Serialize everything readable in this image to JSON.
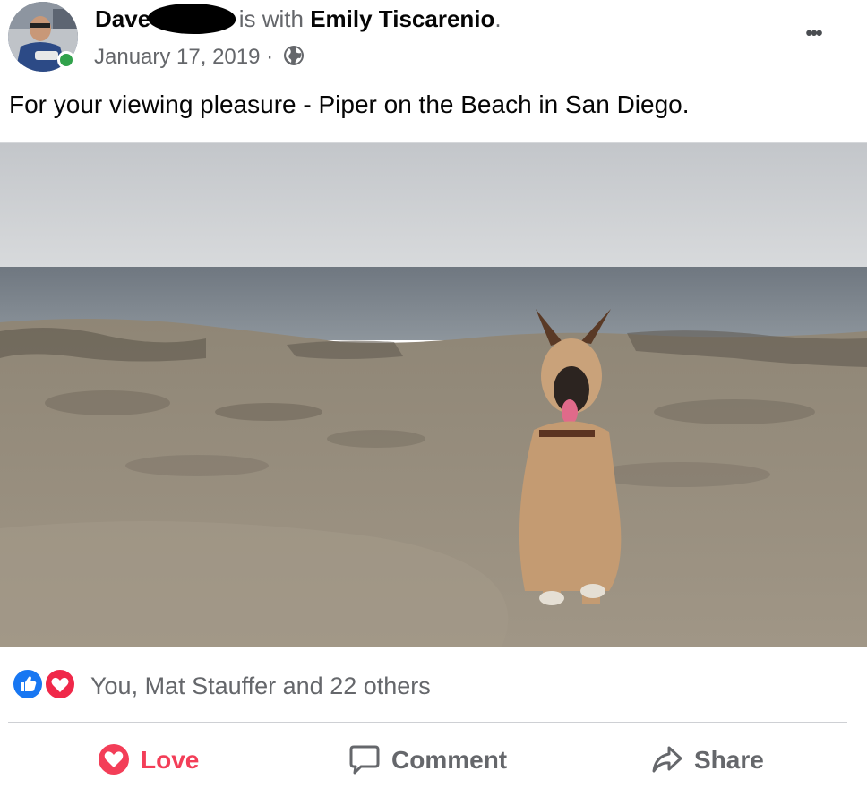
{
  "post": {
    "author_name": "Dave V",
    "is_with_text": "is with",
    "tagged_name": "Emily Tiscarenio",
    "period": ".",
    "date": "January 17, 2019",
    "separator": "·",
    "privacy_icon": "globe-icon",
    "more_label": "•••",
    "text": "For your viewing pleasure - Piper on the Beach in San Diego."
  },
  "reactions": {
    "icons": [
      "like-icon",
      "love-icon"
    ],
    "summary": "You, Mat Stauffer and 22 others"
  },
  "actions": [
    {
      "label": "Love",
      "icon": "love-heart-icon",
      "color": "#f33e58"
    },
    {
      "label": "Comment",
      "icon": "comment-bubble-icon",
      "color": "#65676b"
    },
    {
      "label": "Share",
      "icon": "share-arrow-icon",
      "color": "#65676b"
    }
  ],
  "colors": {
    "like_blue": "#1877f2",
    "love_red": "#f02849",
    "online_green": "#31a24c",
    "secondary_text": "#65676b"
  }
}
